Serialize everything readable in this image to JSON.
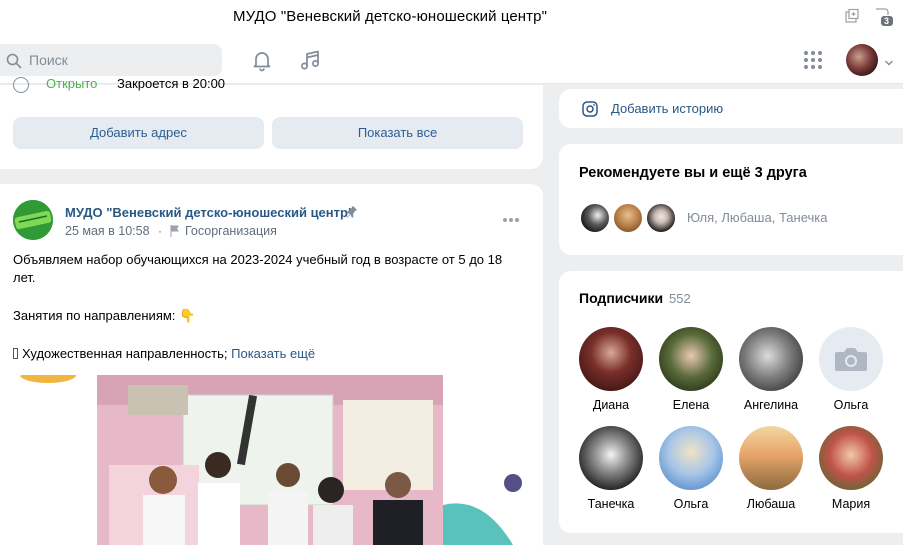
{
  "window": {
    "title": "МУДО \"Веневский детско-юношеский центр\"",
    "badge_count": "3"
  },
  "header": {
    "search_placeholder": "Поиск"
  },
  "top_card": {
    "partial_status_open": "Открыто",
    "partial_status_close": "Закроется в 20:00",
    "add_address_label": "Добавить адрес",
    "show_all_label": "Показать все"
  },
  "post": {
    "author": "МУДО \"Веневский детско-юношеский центр\"",
    "date": "25 мая в 10:58",
    "org_type": "Госорганизация",
    "text_line1": "Объявляем набор обучающихся на 2023-2024 учебный год в возрасте от 5 до 18",
    "text_line2": "лет.",
    "text_line3": "Занятия по направлениям:",
    "text_line3_emoji": "👇",
    "text_line4": "Художественная направленность;",
    "text_line4_prefix": "",
    "show_more": "Показать ещё"
  },
  "sidebar": {
    "add_story_label": "Добавить историю",
    "recommend_title": "Рекомендуете вы и ещё 3 друга",
    "recommend_names": "Юля, Любаша, Танечка",
    "subscribers_title": "Подписчики",
    "subscribers_count": "552",
    "subscribers": [
      {
        "name": "Диана"
      },
      {
        "name": "Елена"
      },
      {
        "name": "Ангелина"
      },
      {
        "name": "Ольга"
      },
      {
        "name": "Танечка"
      },
      {
        "name": "Ольга"
      },
      {
        "name": "Любаша"
      },
      {
        "name": "Мария"
      }
    ]
  },
  "colors": {
    "accent": "#2a5885",
    "button_bg": "#e5ebf1",
    "page_bg": "#edeef0",
    "open_green": "#4bb34b"
  }
}
